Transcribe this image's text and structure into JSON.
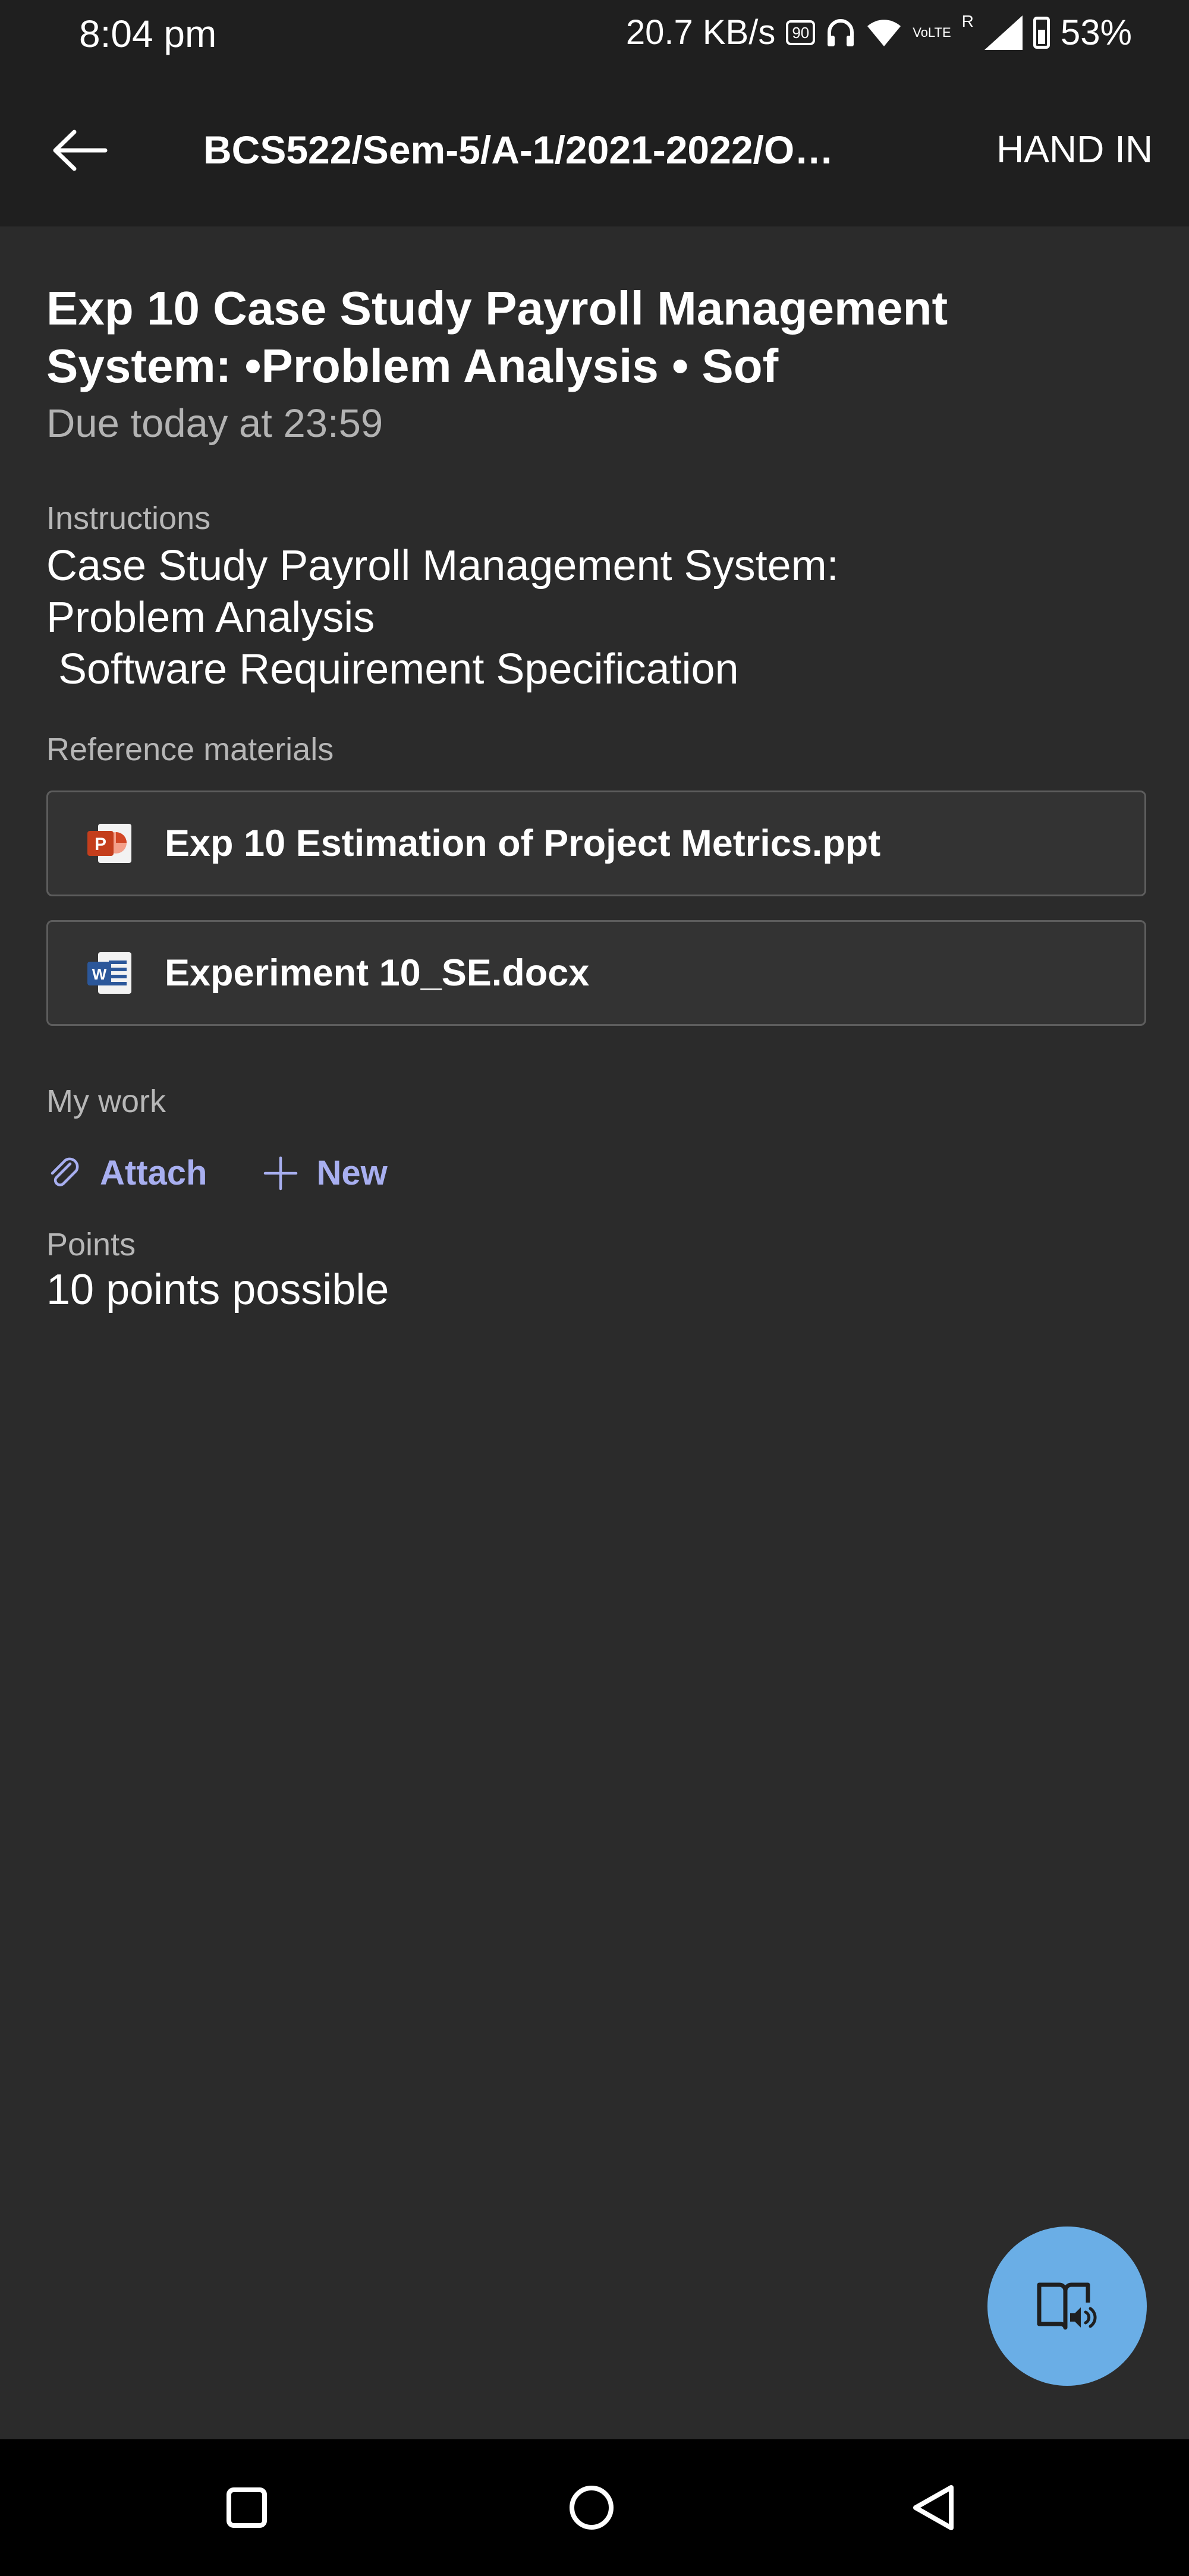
{
  "status_bar": {
    "time": "8:04 pm",
    "speed": "20.7 KB/s",
    "refresh_rate": "90",
    "network_badge": "VoLTE",
    "roaming": "R",
    "battery": "53%"
  },
  "header": {
    "title": "BCS522/Sem-5/A-1/2021-2022/O…",
    "hand_in": "HAND IN"
  },
  "assignment": {
    "title": "Exp 10 Case Study Payroll Management System: •Problem Analysis • Sof",
    "due": "Due today at 23:59",
    "instructions_label": "Instructions",
    "instructions": [
      "Case Study Payroll Management System:",
      "Problem Analysis",
      " Software Requirement Specification"
    ],
    "reference_label": "Reference materials",
    "reference_files": [
      {
        "name": "Exp 10 Estimation of Project Metrics.ppt",
        "icon": "powerpoint-icon",
        "color": "#d24726"
      },
      {
        "name": "Experiment 10_SE.docx",
        "icon": "word-icon",
        "color": "#2b579a"
      }
    ],
    "my_work_label": "My work",
    "attach_label": "Attach",
    "new_label": "New",
    "points_label": "Points",
    "points_value": "10 points possible"
  },
  "colors": {
    "background": "#2b2b2b",
    "bar": "#1f1f1f",
    "accent": "#a8aff0",
    "fab": "#6aaee6"
  }
}
